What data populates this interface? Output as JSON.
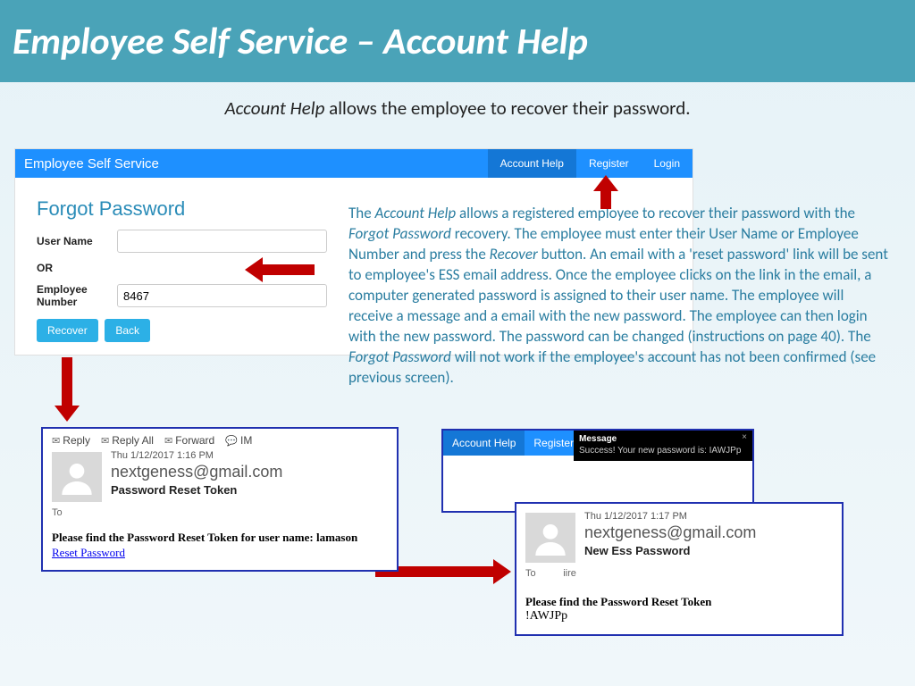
{
  "header": {
    "title": "Employee Self Service – Account Help"
  },
  "intro": {
    "lead": "Account Help",
    "rest": " allows the employee to recover their password."
  },
  "ess": {
    "brand": "Employee Self Service",
    "nav": {
      "account_help": "Account Help",
      "register": "Register",
      "login": "Login"
    },
    "forgot_title": "Forgot Password",
    "labels": {
      "user_name": "User Name",
      "or": "OR",
      "emp_num": "Employee Number"
    },
    "values": {
      "user_name": "",
      "emp_num": "8467"
    },
    "buttons": {
      "recover": "Recover",
      "back": "Back"
    }
  },
  "explain": {
    "p1a": "The ",
    "p1b": "Account Help",
    "p1c": " allows a registered employee to recover their password with the ",
    "p1d": "Forgot Password",
    "p1e": " recovery.  The employee must enter their User Name or Employee Number and press the ",
    "p1f": "Recover",
    "p1g": " button.  An email with a 'reset password' link will be sent to employee's ESS email address.  Once the employee clicks on the link in the email, a computer generated password is assigned to their user name.  The employee will receive a message and a email with the new password.  The employee can then login with the new password.  The password can be changed (instructions on page 40).  The ",
    "p1h": "Forgot Password",
    "p1i": " will not work if the employee's account has not been confirmed (see previous screen)."
  },
  "email1": {
    "actions": {
      "reply": "Reply",
      "reply_all": "Reply All",
      "forward": "Forward",
      "im": "IM"
    },
    "date": "Thu 1/12/2017 1:16 PM",
    "from": "nextgeness@gmail.com",
    "subject": "Password Reset Token",
    "to_label": "To",
    "body_bold": "Please find the Password Reset Token for user name: lamason",
    "link": "Reset Password"
  },
  "notif": {
    "tabs": {
      "account_help": "Account Help",
      "register": "Register"
    },
    "toast_title": "Message",
    "toast_body": "Success! Your new password is: IAWJPp"
  },
  "email2": {
    "date": "Thu 1/12/2017 1:17 PM",
    "from": "nextgeness@gmail.com",
    "subject": "New Ess Password",
    "to_label": "To",
    "to_extra": "iire",
    "body_bold": "Please find the Password Reset Token",
    "password": "!AWJPp"
  }
}
